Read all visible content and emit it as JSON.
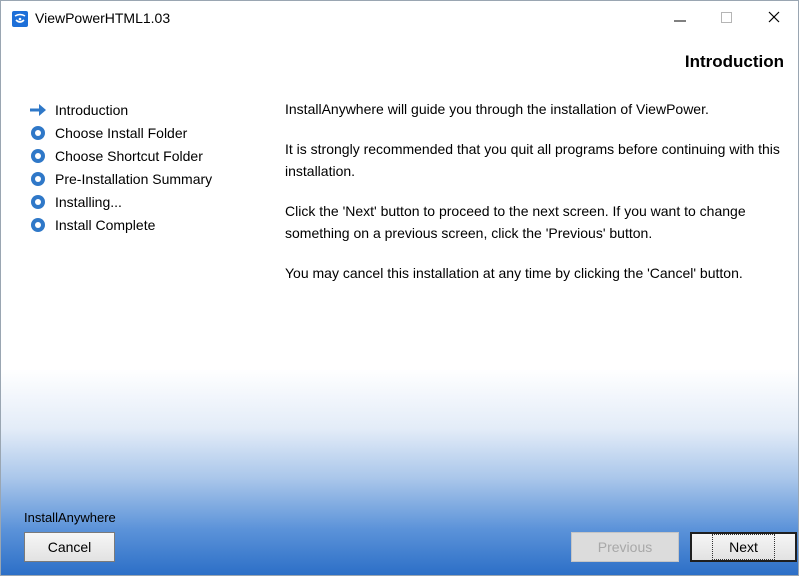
{
  "window": {
    "title": "ViewPowerHTML1.03",
    "controls": {
      "minimize": "–",
      "maximize": "□",
      "close": "✕"
    }
  },
  "header": {
    "title": "Introduction"
  },
  "steps": [
    {
      "label": "Introduction",
      "state": "current"
    },
    {
      "label": "Choose Install Folder",
      "state": "pending"
    },
    {
      "label": "Choose Shortcut Folder",
      "state": "pending"
    },
    {
      "label": "Pre-Installation Summary",
      "state": "pending"
    },
    {
      "label": "Installing...",
      "state": "pending"
    },
    {
      "label": "Install Complete",
      "state": "pending"
    }
  ],
  "body": {
    "paragraphs": [
      "InstallAnywhere will guide you through the installation of ViewPower.",
      "It is strongly recommended that you quit all programs before continuing with this installation.",
      "Click the 'Next' button to proceed to the next screen. If you want to change something on a previous screen, click the 'Previous' button.",
      "You may cancel this installation at any time by clicking the 'Cancel' button."
    ]
  },
  "footer": {
    "brand": "InstallAnywhere",
    "cancel_label": "Cancel",
    "previous_label": "Previous",
    "next_label": "Next"
  },
  "colors": {
    "accent": "#2f78c8",
    "step_pending": "#2f78c8",
    "footer_gradient_end": "#2c6fc7"
  },
  "icons": {
    "app": "viewpower-app-icon",
    "current_step": "arrow-right-icon",
    "pending_step": "circle-bullet-icon"
  }
}
